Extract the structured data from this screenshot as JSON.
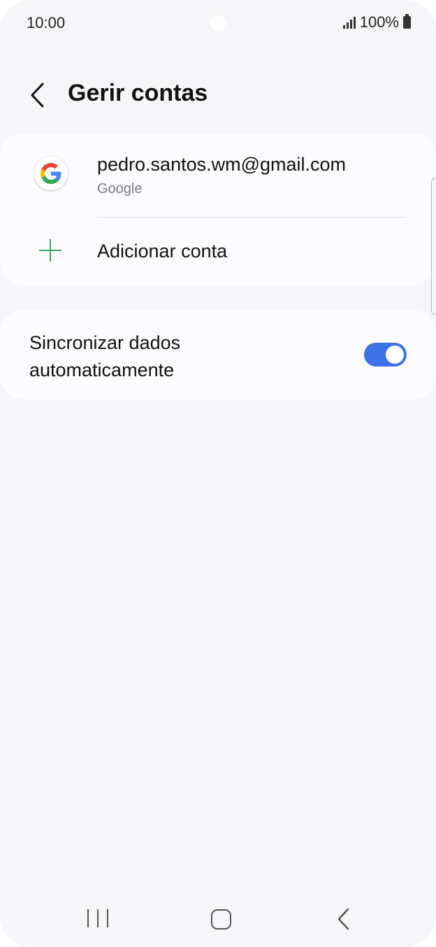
{
  "status_bar": {
    "time": "10:00",
    "battery": "100%",
    "icons": [
      "signal-icon",
      "battery-icon"
    ]
  },
  "header": {
    "title": "Gerir contas",
    "back_icon": "chevron-left-icon"
  },
  "accounts": [
    {
      "email": "pedro.santos.wm@gmail.com",
      "type": "Google",
      "icon": "google-icon"
    }
  ],
  "add_account": {
    "label": "Adicionar conta",
    "icon": "plus-icon",
    "icon_color": "#3aa461"
  },
  "sync": {
    "label": "Sincronizar dados automaticamente",
    "enabled": true,
    "toggle_color": "#3d72e8"
  },
  "nav_bar": {
    "icons": [
      "recents-icon",
      "home-icon",
      "back-icon"
    ]
  }
}
